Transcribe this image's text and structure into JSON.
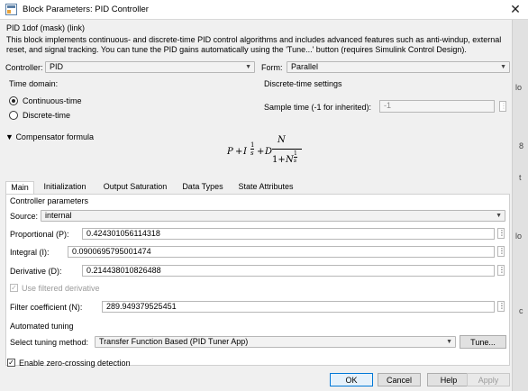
{
  "window": {
    "title": "Block Parameters: PID Controller",
    "close_glyph": "✕"
  },
  "header": {
    "block_name": "PID 1dof (mask) (link)",
    "description": "This block implements continuous- and discrete-time PID control algorithms and includes advanced features such as anti-windup, external reset, and signal tracking. You can tune the PID gains automatically using the 'Tune...' button (requires Simulink Control Design)."
  },
  "controller": {
    "label": "Controller:",
    "value": "PID"
  },
  "form": {
    "label": "Form:",
    "value": "Parallel"
  },
  "time_domain": {
    "title": "Time domain:",
    "options": [
      {
        "label": "Continuous-time",
        "selected": true
      },
      {
        "label": "Discrete-time",
        "selected": false
      }
    ]
  },
  "discrete": {
    "title": "Discrete-time settings",
    "sample_time_label": "Sample time (-1 for inherited):",
    "sample_time_value": "-1"
  },
  "compensator": {
    "label": "Compensator formula",
    "formula": {
      "P": "P",
      "plus": "+",
      "I": "I",
      "one": "1",
      "s": "s",
      "D": "D",
      "N": "N",
      "one_plus": "1+",
      "N2": "N"
    }
  },
  "tabs": [
    {
      "label": "Main",
      "active": true
    },
    {
      "label": "Initialization",
      "active": false
    },
    {
      "label": "Output Saturation",
      "active": false
    },
    {
      "label": "Data Types",
      "active": false
    },
    {
      "label": "State Attributes",
      "active": false
    }
  ],
  "main": {
    "section": "Controller parameters",
    "source_label": "Source:",
    "source_value": "internal",
    "proportional_label": "Proportional (P):",
    "proportional_value": "0.424301056114318",
    "integral_label": "Integral (I):",
    "integral_value": "0.0900695795001474",
    "derivative_label": "Derivative (D):",
    "derivative_value": "0.214438010826488",
    "filtered_label": "Use filtered derivative",
    "filtered_checked": true,
    "filter_label": "Filter coefficient (N):",
    "filter_value": "289.949379525451",
    "tuning_section": "Automated tuning",
    "tuning_method_label": "Select tuning method:",
    "tuning_method_value": "Transfer Function Based (PID Tuner App)",
    "tune_button": "Tune...",
    "zero_crossing_label": "Enable zero-crossing detection",
    "zero_crossing_checked": true
  },
  "buttons": {
    "ok": "OK",
    "cancel": "Cancel",
    "help": "Help",
    "apply": "Apply"
  },
  "background": {
    "glyphs": [
      "lo",
      "8",
      "t",
      "lo",
      "c"
    ]
  },
  "colors": {
    "accent": "#0078d7",
    "panel": "#f0f0f0",
    "titlebar": "#ffffff"
  }
}
